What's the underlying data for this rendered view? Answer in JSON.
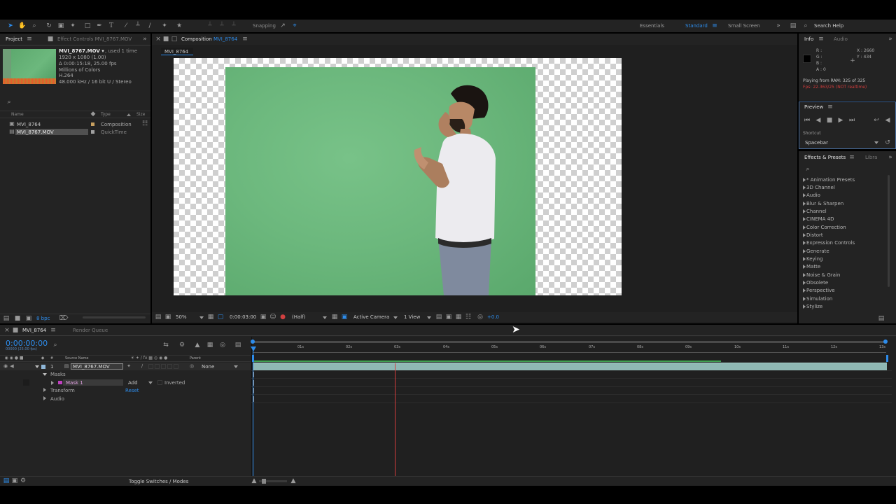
{
  "toolbar": {
    "snapping_label": "Snapping",
    "workspaces": [
      "Essentials",
      "Standard",
      "Small Screen"
    ],
    "search_help": "Search Help"
  },
  "project": {
    "tab_project": "Project",
    "tab_effect_controls": "Effect Controls",
    "effect_controls_target": "MVI_8767.MOV",
    "asset_name": "MVI_8767.MOV ▾",
    "used_times": ", used 1 time",
    "asset_info": [
      "1920 x 1080 (1.00)",
      "Δ 0:00:15:18, 25.00 fps",
      "Millions of Colors",
      "H.264",
      "48.000 kHz / 16 bit U / Stereo"
    ],
    "col_name": "Name",
    "col_type": "Type",
    "col_size": "Size",
    "items": [
      {
        "name": "MVI_8764",
        "type": "Composition",
        "color": "#c8a060"
      },
      {
        "name": "MVI_8767.MOV",
        "type": "QuickTime",
        "color": "#a0a0a0"
      }
    ],
    "bpc": "8 bpc"
  },
  "composition": {
    "tab_label": "Composition",
    "comp_name": "MVI_8764",
    "sub_tab": "MVI_8764",
    "zoom": "50%",
    "timecode": "0:00:03:00",
    "resolution": "(Half)",
    "camera": "Active Camera",
    "views": "1 View",
    "exposure": "+0.0"
  },
  "info": {
    "tab_info": "Info",
    "tab_audio": "Audio",
    "r": "R :",
    "g": "G :",
    "b": "B :",
    "a": "A : 0",
    "x": "X : 2660",
    "y": "Y : 434",
    "playing": "Playing from RAM: 325 of 325",
    "fps_warn": "Fps: 22.363/25 (NOT realtime)"
  },
  "preview": {
    "title": "Preview",
    "shortcut_label": "Shortcut",
    "shortcut_value": "Spacebar"
  },
  "effects": {
    "title": "Effects & Presets",
    "tab_libra": "Libra",
    "items": [
      "* Animation Presets",
      "3D Channel",
      "Audio",
      "Blur & Sharpen",
      "Channel",
      "CINEMA 4D",
      "Color Correction",
      "Distort",
      "Expression Controls",
      "Generate",
      "Keying",
      "Matte",
      "Noise & Grain",
      "Obsolete",
      "Perspective",
      "Simulation",
      "Stylize"
    ]
  },
  "timeline": {
    "tab_comp": "MVI_8764",
    "tab_render": "Render Queue",
    "timecode": "0:00:00:00",
    "timecode_sub": "00000 (25.00 fps)",
    "col_source": "Source Name",
    "col_parent": "Parent",
    "layer_num": "1",
    "layer_name": "MVI_8767.MOV",
    "parent_value": "None",
    "masks": "Masks",
    "mask1": "Mask 1",
    "mask_mode": "Add",
    "inverted": "Inverted",
    "transform": "Transform",
    "reset": "Reset",
    "audio": "Audio",
    "ruler": [
      "01s",
      "02s",
      "03s",
      "04s",
      "05s",
      "06s",
      "07s",
      "08s",
      "09s",
      "10s",
      "11s",
      "12s",
      "13s"
    ],
    "toggle_label": "Toggle Switches / Modes"
  },
  "colors": {
    "accent": "#2d8ceb",
    "green_screen": "#6cb87d",
    "warn": "#d23c3c"
  }
}
